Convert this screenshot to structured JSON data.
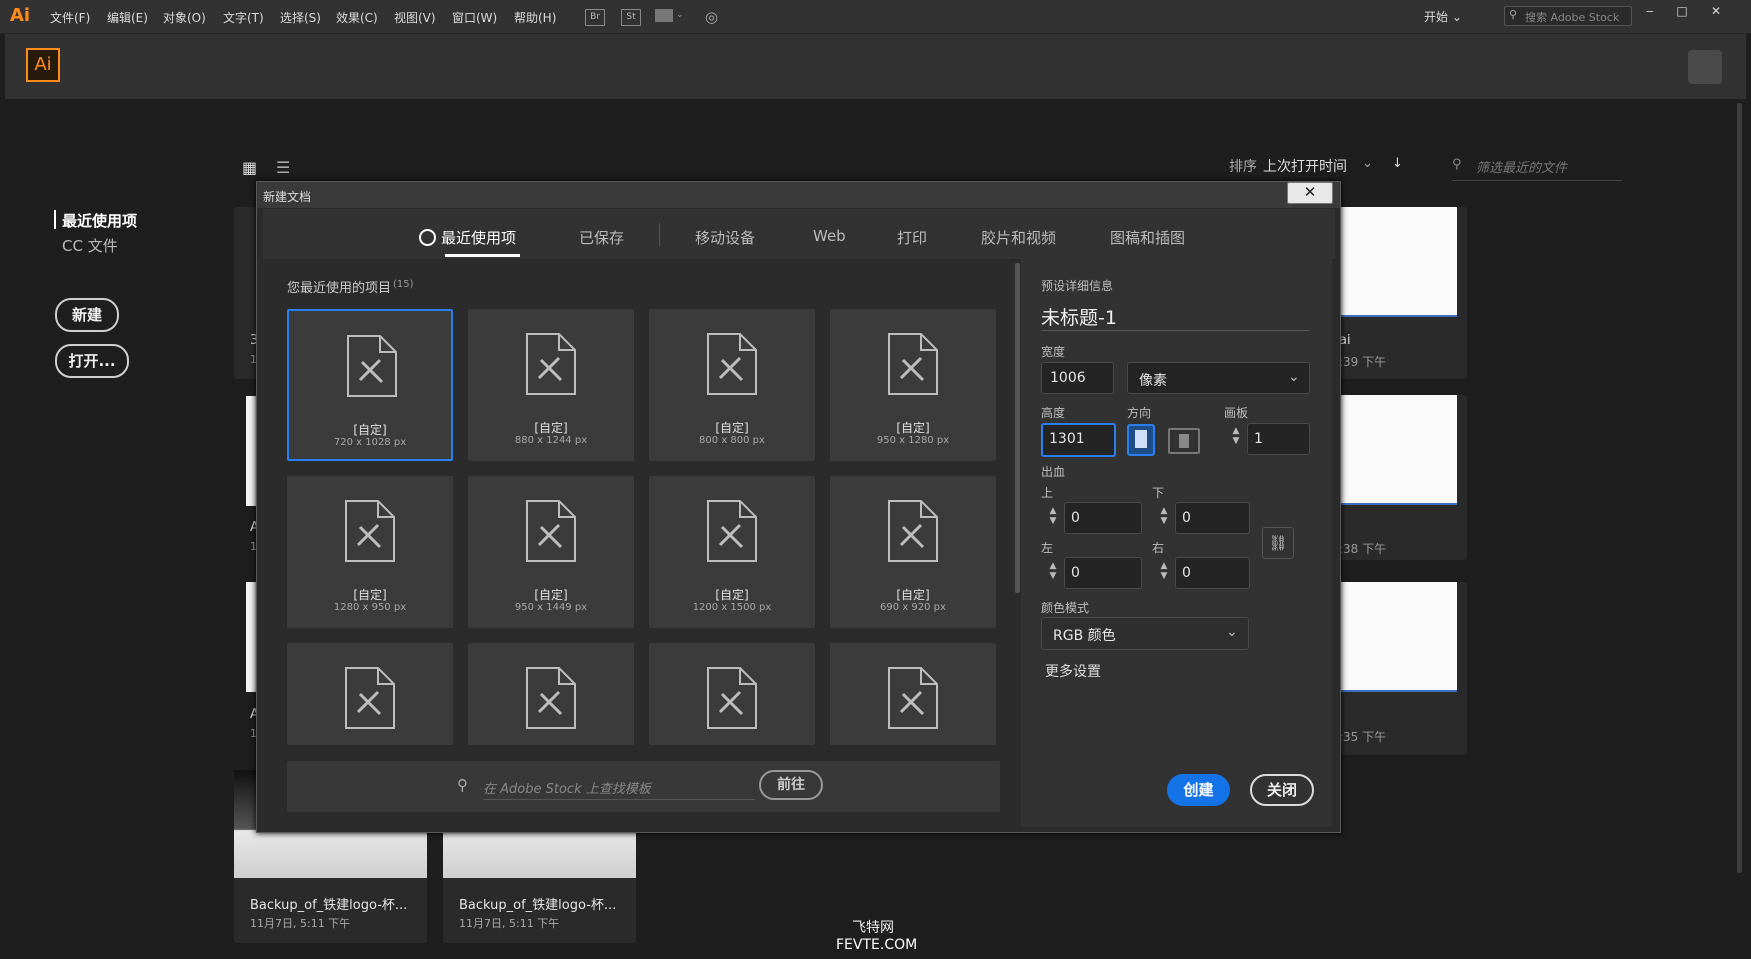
{
  "menubar": {
    "logo": "Ai",
    "items": [
      "文件(F)",
      "编辑(E)",
      "对象(O)",
      "文字(T)",
      "选择(S)",
      "效果(C)",
      "视图(V)",
      "窗口(W)",
      "帮助(H)"
    ],
    "br": "Br",
    "st": "St",
    "workspace": "开始",
    "stock_placeholder": "搜索 Adobe Stock"
  },
  "home": {
    "logo": "Ai",
    "nav": [
      "最近使用项",
      "CC 文件"
    ],
    "new_label": "新建",
    "open_label": "打开...",
    "sort_label": "排序",
    "sort_value": "上次打开时间",
    "filter_placeholder": "筛选最近的文件",
    "files": [
      {
        "name": "Backup_of_铁建logo-杯...",
        "date": "11月7日, 5:11 下午"
      },
      {
        "name": "Backup_of_铁建logo-杯...",
        "date": "11月7日, 5:11 下午"
      }
    ],
    "partial": [
      "3",
      "1",
      "A",
      "1",
      "A",
      "1",
      "ai",
      ":39 下午",
      ":38 下午",
      ":35 下午"
    ]
  },
  "dialog": {
    "title": "新建文档",
    "close": "✕",
    "tabs": [
      "最近使用项",
      "已保存",
      "移动设备",
      "Web",
      "打印",
      "胶片和视频",
      "图稿和插图"
    ],
    "recent_heading": "您最近使用的项目",
    "recent_count": "(15)",
    "templates": [
      {
        "name": "[自定]",
        "size": "720 x 1028 px"
      },
      {
        "name": "[自定]",
        "size": "880 x 1244 px"
      },
      {
        "name": "[自定]",
        "size": "800 x 800 px"
      },
      {
        "name": "[自定]",
        "size": "950 x 1280 px"
      },
      {
        "name": "[自定]",
        "size": "1280 x 950 px"
      },
      {
        "name": "[自定]",
        "size": "950 x 1449 px"
      },
      {
        "name": "[自定]",
        "size": "1200 x 1500 px"
      },
      {
        "name": "[自定]",
        "size": "690 x 920 px"
      },
      {
        "name": "",
        "size": ""
      },
      {
        "name": "",
        "size": ""
      },
      {
        "name": "",
        "size": ""
      },
      {
        "name": "",
        "size": ""
      }
    ],
    "stock_search_placeholder": "在 Adobe Stock 上查找模板",
    "go_label": "前往",
    "preset": {
      "heading": "预设详细信息",
      "doc_name": "未标题-1",
      "width_label": "宽度",
      "width_value": "1006",
      "unit": "像素",
      "height_label": "高度",
      "height_value": "1301",
      "orientation_label": "方向",
      "artboards_label": "画板",
      "artboards_value": "1",
      "bleed_label": "出血",
      "top_label": "上",
      "top_value": "0",
      "bottom_label": "下",
      "bottom_value": "0",
      "left_label": "左",
      "left_value": "0",
      "right_label": "右",
      "right_value": "0",
      "color_mode_label": "颜色模式",
      "color_mode_value": "RGB 颜色",
      "more_settings": "更多设置",
      "create_label": "创建",
      "close_label": "关闭"
    }
  },
  "watermark": {
    "line1": "飞特网",
    "line2": "FEVTE.COM"
  },
  "colors": {
    "accent": "#2a80f0",
    "brand": "#ff8c1a",
    "create_button": "#1473e6"
  }
}
